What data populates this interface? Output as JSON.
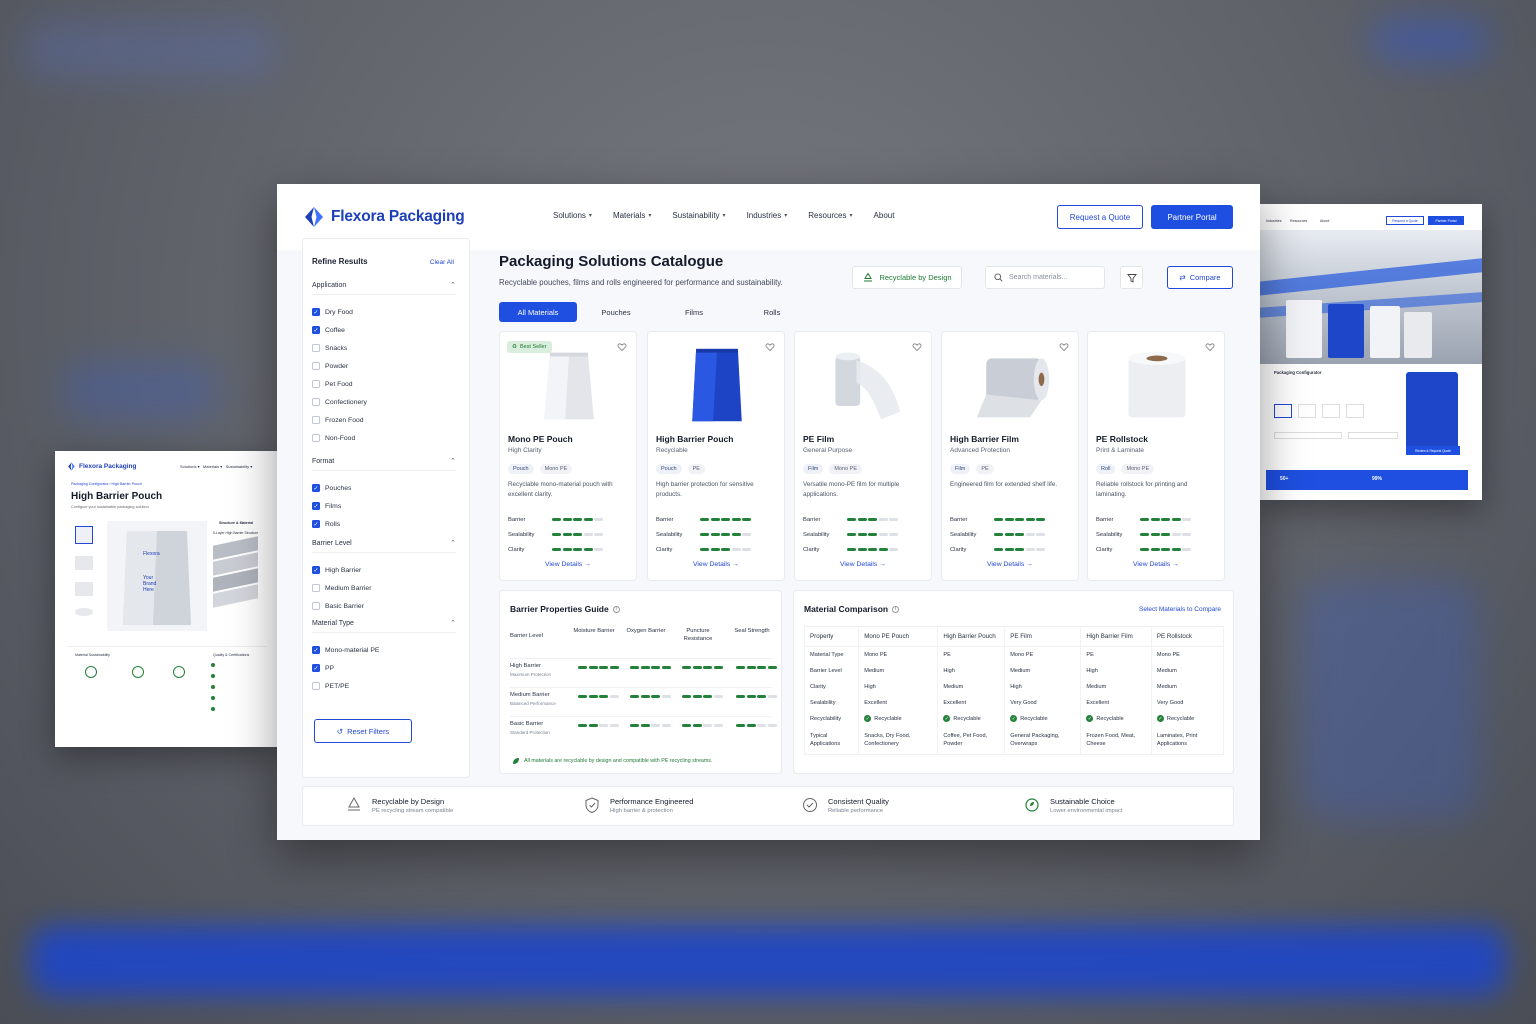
{
  "brand": {
    "name": "Flexora Packaging",
    "accent": "#1e4fe0"
  },
  "nav": {
    "items": [
      "Solutions",
      "Materials",
      "Sustainability",
      "Industries",
      "Resources",
      "About"
    ],
    "quote_button": "Request a Quote",
    "partner_button": "Partner Portal"
  },
  "sidebar": {
    "title": "Refine Results",
    "clear": "Clear All",
    "groups": [
      {
        "title": "Application",
        "options": [
          {
            "label": "Dry Food",
            "checked": true
          },
          {
            "label": "Coffee",
            "checked": true
          },
          {
            "label": "Snacks",
            "checked": false
          },
          {
            "label": "Powder",
            "checked": false
          },
          {
            "label": "Pet Food",
            "checked": false
          },
          {
            "label": "Confectionery",
            "checked": false
          },
          {
            "label": "Frozen Food",
            "checked": false
          },
          {
            "label": "Non-Food",
            "checked": false
          }
        ]
      },
      {
        "title": "Format",
        "options": [
          {
            "label": "Pouches",
            "checked": true
          },
          {
            "label": "Films",
            "checked": true
          },
          {
            "label": "Rolls",
            "checked": true
          }
        ]
      },
      {
        "title": "Barrier Level",
        "options": [
          {
            "label": "High Barrier",
            "checked": true
          },
          {
            "label": "Medium Barrier",
            "checked": false
          },
          {
            "label": "Basic Barrier",
            "checked": false
          }
        ]
      },
      {
        "title": "Material Type",
        "options": [
          {
            "label": "Mono-material PE",
            "checked": true
          },
          {
            "label": "PP",
            "checked": true
          },
          {
            "label": "PET/PE",
            "checked": false
          }
        ]
      }
    ],
    "reset": "Reset Filters"
  },
  "catalogue": {
    "title": "Packaging Solutions Catalogue",
    "subtitle": "Recyclable pouches, films and rolls engineered for performance and sustainability.",
    "recyclable_badge": "Recyclable by Design",
    "search_placeholder": "Search materials...",
    "compare": "Compare",
    "tabs": [
      "All Materials",
      "Pouches",
      "Films",
      "Rolls"
    ]
  },
  "metric_labels": [
    "Barrier",
    "Sealability",
    "Clarity"
  ],
  "products": [
    {
      "name": "Mono PE Pouch",
      "sub": "High Clarity",
      "tags": [
        "Pouch",
        "Mono PE"
      ],
      "desc": "Recyclable mono-material pouch with excellent clarity.",
      "badge": "Best Seller",
      "scores": [
        4,
        3,
        4
      ],
      "link": "View Details"
    },
    {
      "name": "High Barrier Pouch",
      "sub": "Recyclable",
      "tags": [
        "Pouch",
        "PE"
      ],
      "desc": "High barrier protection for sensitive products.",
      "badge": "",
      "scores": [
        5,
        4,
        3
      ],
      "link": "View Details"
    },
    {
      "name": "PE Film",
      "sub": "General Purpose",
      "tags": [
        "Film",
        "Mono PE"
      ],
      "desc": "Versatile mono-PE film for multiple applications.",
      "badge": "",
      "scores": [
        3,
        3,
        4
      ],
      "link": "View Details"
    },
    {
      "name": "High Barrier Film",
      "sub": "Advanced Protection",
      "tags": [
        "Film",
        "PE"
      ],
      "desc": "Engineered film for extended shelf life.",
      "badge": "",
      "scores": [
        5,
        3,
        3
      ],
      "link": "View Details"
    },
    {
      "name": "PE Rollstock",
      "sub": "Print & Laminate",
      "tags": [
        "Roll",
        "Mono PE"
      ],
      "desc": "Reliable rollstock for printing and laminating.",
      "badge": "",
      "scores": [
        4,
        3,
        4
      ],
      "link": "View Details"
    }
  ],
  "guide": {
    "title": "Barrier Properties Guide",
    "columns": [
      "Barrier Level",
      "Moisture Barrier",
      "Oxygen Barrier",
      "Puncture Resistance",
      "Seal Strength"
    ],
    "rows": [
      {
        "name": "High Barrier",
        "desc": "Maximum Protection",
        "scores": [
          4,
          4,
          4,
          4
        ]
      },
      {
        "name": "Medium Barrier",
        "desc": "Balanced Performance",
        "scores": [
          3,
          3,
          3,
          3
        ]
      },
      {
        "name": "Basic Barrier",
        "desc": "Standard Protection",
        "scores": [
          2,
          2,
          2,
          2
        ]
      }
    ],
    "note": "All materials are recyclable by design and compatible with PE recycling streams."
  },
  "comparison": {
    "title": "Material Comparison",
    "link": "Select Materials to Compare",
    "header": [
      "Property",
      "Mono PE Pouch",
      "High Barrier Pouch",
      "PE Film",
      "High Barrier Film",
      "PE Rollstock"
    ],
    "rows": [
      [
        "Material Type",
        "Mono PE",
        "PE",
        "Mono PE",
        "PE",
        "Mono PE"
      ],
      [
        "Barrier Level",
        "Medium",
        "High",
        "Medium",
        "High",
        "Medium"
      ],
      [
        "Clarity",
        "High",
        "Medium",
        "High",
        "Medium",
        "Medium"
      ],
      [
        "Sealability",
        "Excellent",
        "Excellent",
        "Very Good",
        "Excellent",
        "Very Good"
      ],
      [
        "Recyclability",
        "Recyclable",
        "Recyclable",
        "Recyclable",
        "Recyclable",
        "Recyclable"
      ],
      [
        "Typical Applications",
        "Snacks, Dry Food, Confectionery",
        "Coffee, Pet Food, Powder",
        "General Packaging, Overwraps",
        "Frozen Food, Meat, Cheese",
        "Laminates, Print Applications"
      ]
    ]
  },
  "features": [
    {
      "title": "Recyclable by Design",
      "sub": "PE recycling stream compatible",
      "icon": "recycle-icon"
    },
    {
      "title": "Performance Engineered",
      "sub": "High barrier & protection",
      "icon": "shield-icon"
    },
    {
      "title": "Consistent Quality",
      "sub": "Reliable performance",
      "icon": "quality-icon"
    },
    {
      "title": "Sustainable Choice",
      "sub": "Lower environmental impact",
      "icon": "leaf-cycle-icon"
    }
  ],
  "left_screen": {
    "brand": "Flexora Packaging",
    "breadcrumb": "Packaging Configurator  /  High Barrier Pouch",
    "title": "High Barrier Pouch",
    "subtitle": "Configure your sustainable packaging solution.",
    "section": "Structure & Material",
    "structure": "5-Layer High Barrier Structure",
    "sustain": "Material Sustainability",
    "quality": "Quality & Certifications"
  },
  "right_screen": {
    "nav": [
      "Industries",
      "Resources",
      "About"
    ],
    "quote": "Request a Quote",
    "partner": "Partner Portal",
    "configurator": "Packaging Configurator",
    "stat1": "50+",
    "stat2": "99%",
    "cta": "Review & Request Quote"
  }
}
